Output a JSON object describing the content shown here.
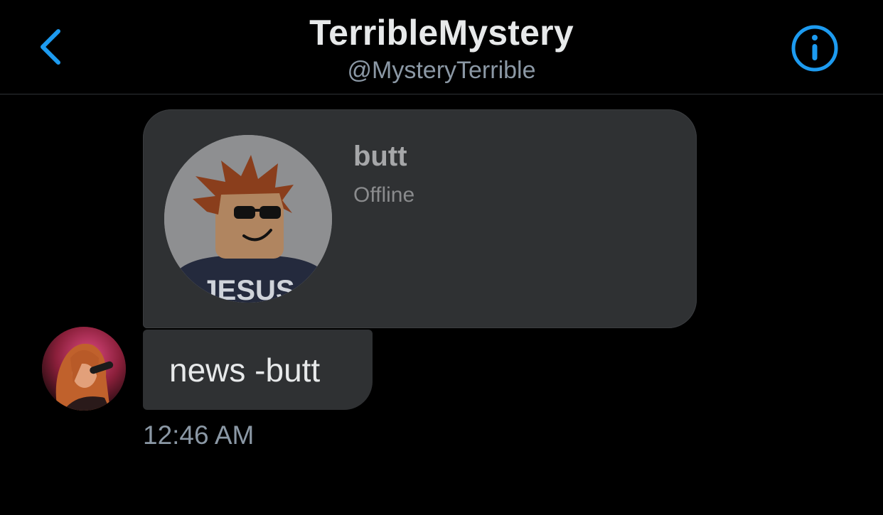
{
  "header": {
    "title": "TerribleMystery",
    "handle": "@MysteryTerrible",
    "back_icon": "chevron-left-icon",
    "info_icon": "info-circle-icon",
    "accent_color": "#1d9bf0"
  },
  "card": {
    "name": "butt",
    "status": "Offline",
    "avatar_shirt_text": "JESUS"
  },
  "message": {
    "text": "news -butt",
    "timestamp": "12:46 AM"
  }
}
